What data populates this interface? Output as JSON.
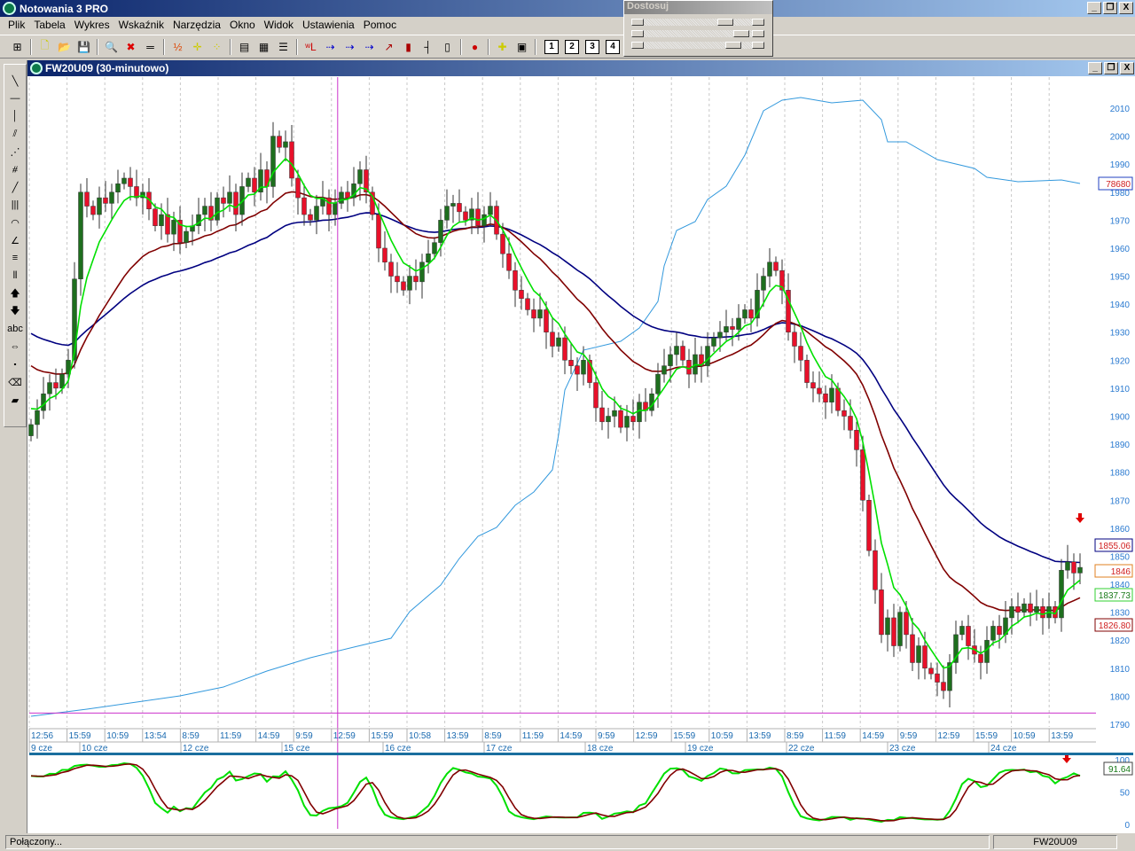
{
  "app": {
    "title": "Notowania 3 PRO",
    "window_controls": [
      "_",
      "❐",
      "X"
    ]
  },
  "menu": [
    "Plik",
    "Tabela",
    "Wykres",
    "Wskaźnik",
    "Narzędzia",
    "Okno",
    "Widok",
    "Ustawienia",
    "Pomoc"
  ],
  "toolbar": {
    "icons": [
      "grid-icon",
      "new-file-icon",
      "open-folder-icon",
      "save-icon",
      "zoom-icon",
      "delete-icon",
      "ruler-icon",
      "numbers-icon",
      "crosshair-icon",
      "points-icon",
      "table-icon",
      "color-layout-icon",
      "list-icon",
      "wl-icon",
      "arrow-series-1-icon",
      "arrow-series-2-icon",
      "arrow-series-3-icon",
      "line-chart-icon",
      "bar-chart-icon",
      "ohlc-icon",
      "candle-icon",
      "traffic-light-icon",
      "add-marker-icon",
      "add-window-icon"
    ],
    "layouts": [
      "1",
      "2",
      "3",
      "4"
    ]
  },
  "adjust_panel": {
    "title": "Dostosuj",
    "sliders": [
      0.8,
      0.97,
      0.88
    ]
  },
  "drawing_tools": [
    "trendline-icon",
    "horizontal-line-icon",
    "vertical-line-icon",
    "parallel-lines-icon",
    "fan-icon",
    "gann-icon",
    "line-icon",
    "vertical-lines-icon",
    "arcs-icon",
    "fan-lines-icon",
    "fibonacci-icon",
    "time-zones-icon",
    "arrow-up-icon",
    "arrow-down-icon",
    "text-icon",
    "move-icon",
    "select-icon",
    "eraser-icon",
    "eraser-all-icon"
  ],
  "drawing_text": "abc",
  "chart_window": {
    "title": "FW20U09 (30-minutowo)"
  },
  "chart_data": {
    "type": "candlestick",
    "symbol": "FW20U09",
    "interval": "30-minutowo",
    "ylim": [
      1790,
      2010
    ],
    "y_ticks": [
      1790,
      1800,
      1810,
      1820,
      1830,
      1840,
      1850,
      1860,
      1870,
      1880,
      1890,
      1900,
      1910,
      1920,
      1930,
      1940,
      1950,
      1960,
      1970,
      1980,
      1990,
      2000,
      2010
    ],
    "time_labels": [
      "12:56",
      "15:59",
      "10:59",
      "13:54",
      "8:59",
      "11:59",
      "14:59",
      "9:59",
      "12:59",
      "15:59",
      "10:58",
      "13:59",
      "8:59",
      "11:59",
      "14:59",
      "9:59",
      "12:59",
      "15:59",
      "10:59",
      "13:59",
      "8:59",
      "11:59",
      "14:59",
      "9:59",
      "12:59",
      "15:59",
      "10:59",
      "13:59"
    ],
    "date_labels": [
      "9 cze",
      "10 cze",
      "12 cze",
      "15 cze",
      "16 cze",
      "17 cze",
      "18 cze",
      "19 cze",
      "22 cze",
      "23 cze",
      "24 cze"
    ],
    "first_open": 1893,
    "closes": [
      1897,
      1902,
      1908,
      1912,
      1910,
      1915,
      1920,
      1949,
      1980,
      1975,
      1972,
      1978,
      1976,
      1980,
      1983,
      1985,
      1982,
      1978,
      1980,
      1974,
      1968,
      1972,
      1965,
      1970,
      1962,
      1966,
      1968,
      1972,
      1975,
      1970,
      1978,
      1976,
      1980,
      1972,
      1982,
      1985,
      1980,
      1988,
      1982,
      2000,
      1996,
      1998,
      1985,
      1978,
      1972,
      1970,
      1975,
      1978,
      1972,
      1976,
      1980,
      1978,
      1983,
      1988,
      1980,
      1972,
      1960,
      1955,
      1950,
      1948,
      1945,
      1950,
      1948,
      1955,
      1958,
      1962,
      1970,
      1975,
      1976,
      1973,
      1970,
      1974,
      1968,
      1972,
      1975,
      1965,
      1958,
      1952,
      1945,
      1942,
      1938,
      1935,
      1938,
      1930,
      1925,
      1928,
      1920,
      1918,
      1915,
      1920,
      1912,
      1903,
      1898,
      1900,
      1902,
      1896,
      1900,
      1898,
      1905,
      1902,
      1908,
      1915,
      1918,
      1922,
      1925,
      1920,
      1915,
      1922,
      1918,
      1925,
      1928,
      1930,
      1932,
      1931,
      1935,
      1938,
      1935,
      1945,
      1950,
      1955,
      1952,
      1945,
      1930,
      1925,
      1920,
      1912,
      1910,
      1908,
      1905,
      1910,
      1902,
      1900,
      1895,
      1888,
      1870,
      1852,
      1838,
      1822,
      1828,
      1818,
      1830,
      1822,
      1812,
      1818,
      1810,
      1808,
      1805,
      1802,
      1812,
      1822,
      1825,
      1818,
      1815,
      1812,
      1820,
      1825,
      1822,
      1828,
      1832,
      1830,
      1833,
      1830,
      1832,
      1828,
      1832,
      1828,
      1845,
      1848,
      1844,
      1846
    ],
    "series": [
      {
        "name": "short MA",
        "color": "#00e000",
        "last": "1837.73"
      },
      {
        "name": "medium MA",
        "color": "#800000",
        "last": "1826.80"
      },
      {
        "name": "long MA",
        "color": "#000080",
        "last": "1855.06"
      },
      {
        "name": "open interest",
        "color": "#3399dd",
        "last": "78680",
        "points": [
          [
            0,
            48630
          ],
          [
            9,
            49030
          ],
          [
            24,
            49780
          ],
          [
            31,
            50280
          ],
          [
            38,
            51180
          ],
          [
            45,
            51930
          ],
          [
            52,
            52530
          ],
          [
            58,
            53030
          ],
          [
            61,
            54530
          ],
          [
            66,
            56030
          ],
          [
            69,
            57530
          ],
          [
            72,
            58780
          ],
          [
            75,
            59280
          ],
          [
            78,
            60530
          ],
          [
            81,
            61280
          ],
          [
            84,
            62530
          ],
          [
            85,
            64530
          ],
          [
            86,
            67030
          ],
          [
            89,
            69280
          ],
          [
            95,
            69780
          ],
          [
            98,
            70530
          ],
          [
            101,
            72030
          ],
          [
            102,
            74030
          ],
          [
            104,
            76030
          ],
          [
            107,
            76530
          ],
          [
            109,
            77780
          ],
          [
            112,
            78530
          ],
          [
            115,
            80280
          ],
          [
            118,
            82780
          ],
          [
            121,
            83380
          ],
          [
            124,
            83530
          ],
          [
            129,
            83230
          ],
          [
            134,
            83380
          ],
          [
            137,
            82280
          ],
          [
            138,
            81030
          ],
          [
            141,
            81030
          ],
          [
            146,
            80030
          ],
          [
            152,
            79530
          ],
          [
            154,
            79030
          ],
          [
            159,
            78780
          ],
          [
            166,
            78880
          ],
          [
            169,
            78680
          ]
        ]
      }
    ],
    "last_price": "1846",
    "crosshair": {
      "index": 49.4,
      "price": 1794
    },
    "signal": {
      "type": "sell-arrow",
      "color": "#e00000",
      "index": 169
    },
    "oscillator": {
      "type": "stochastic",
      "ylim": [
        0,
        100
      ],
      "y_ticks": [
        "100",
        "50",
        "0"
      ],
      "last": "91.64",
      "k_color": "#00e000",
      "d_color": "#800000"
    }
  },
  "status": {
    "left": "Połączony...",
    "right": "FW20U09"
  }
}
